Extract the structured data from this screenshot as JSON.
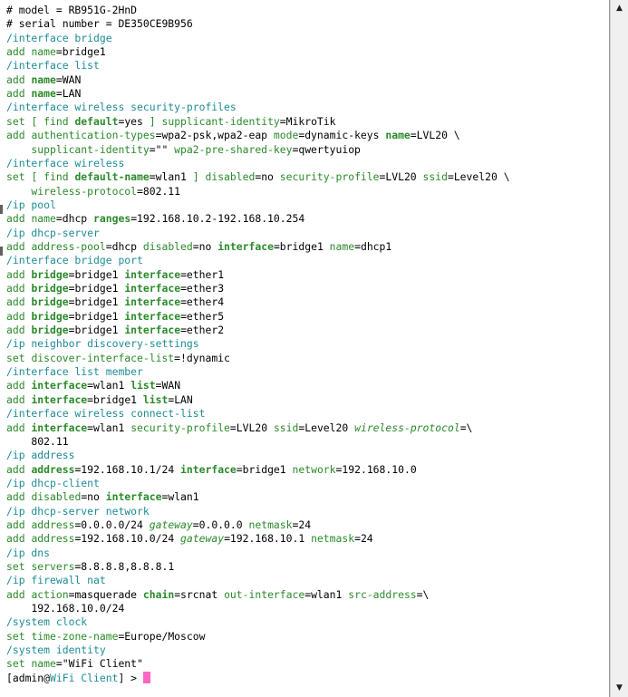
{
  "terminal": {
    "lines": [
      [
        {
          "t": "# model = RB951G-2HnD",
          "c": "c-val"
        }
      ],
      [
        {
          "t": "# serial number = DE350CE9B956",
          "c": "c-val"
        }
      ],
      [
        {
          "t": "/interface bridge",
          "c": "c-section"
        }
      ],
      [
        {
          "t": "add ",
          "c": "c-cmd"
        },
        {
          "t": "name",
          "c": "c-param"
        },
        {
          "t": "=bridge1",
          "c": "c-val"
        }
      ],
      [
        {
          "t": "/interface list",
          "c": "c-section"
        }
      ],
      [
        {
          "t": "add ",
          "c": "c-cmd"
        },
        {
          "t": "name",
          "c": "c-bparam"
        },
        {
          "t": "=WAN",
          "c": "c-val"
        }
      ],
      [
        {
          "t": "add ",
          "c": "c-cmd"
        },
        {
          "t": "name",
          "c": "c-bparam"
        },
        {
          "t": "=LAN",
          "c": "c-val"
        }
      ],
      [
        {
          "t": "/interface wireless security-profiles",
          "c": "c-section"
        }
      ],
      [
        {
          "t": "set ",
          "c": "c-cmd"
        },
        {
          "t": "[ find ",
          "c": "c-param"
        },
        {
          "t": "default",
          "c": "c-bparam"
        },
        {
          "t": "=yes ",
          "c": "c-val"
        },
        {
          "t": "] supplicant-identity",
          "c": "c-param"
        },
        {
          "t": "=MikroTik",
          "c": "c-val"
        }
      ],
      [
        {
          "t": "add ",
          "c": "c-cmd"
        },
        {
          "t": "authentication-types",
          "c": "c-param"
        },
        {
          "t": "=wpa2-psk,wpa2-eap ",
          "c": "c-val"
        },
        {
          "t": "mode",
          "c": "c-param"
        },
        {
          "t": "=dynamic-keys ",
          "c": "c-val"
        },
        {
          "t": "name",
          "c": "c-bparam"
        },
        {
          "t": "=LVL20 \\",
          "c": "c-val"
        }
      ],
      [
        {
          "t": "    supplicant-identity",
          "c": "c-param"
        },
        {
          "t": "=\"\" ",
          "c": "c-val"
        },
        {
          "t": "wpa2-pre-shared-key",
          "c": "c-param"
        },
        {
          "t": "=qwertyuiop",
          "c": "c-val"
        }
      ],
      [
        {
          "t": "/interface wireless",
          "c": "c-section"
        }
      ],
      [
        {
          "t": "set ",
          "c": "c-cmd"
        },
        {
          "t": "[ find ",
          "c": "c-param"
        },
        {
          "t": "default-name",
          "c": "c-bparam"
        },
        {
          "t": "=wlan1 ",
          "c": "c-val"
        },
        {
          "t": "] disabled",
          "c": "c-param"
        },
        {
          "t": "=no ",
          "c": "c-val"
        },
        {
          "t": "security-profile",
          "c": "c-param"
        },
        {
          "t": "=LVL20 ",
          "c": "c-val"
        },
        {
          "t": "ssid",
          "c": "c-param"
        },
        {
          "t": "=Level20 \\",
          "c": "c-val"
        }
      ],
      [
        {
          "t": "    wireless-protocol",
          "c": "c-param"
        },
        {
          "t": "=802.11",
          "c": "c-val"
        }
      ],
      [
        {
          "t": "/ip pool",
          "c": "c-section"
        }
      ],
      [
        {
          "t": "add ",
          "c": "c-cmd"
        },
        {
          "t": "name",
          "c": "c-param"
        },
        {
          "t": "=dhcp ",
          "c": "c-val"
        },
        {
          "t": "ranges",
          "c": "c-bparam"
        },
        {
          "t": "=192.168.10.2-192.168.10.254",
          "c": "c-val"
        }
      ],
      [
        {
          "t": "/ip dhcp-server",
          "c": "c-section"
        }
      ],
      [
        {
          "t": "add ",
          "c": "c-cmd"
        },
        {
          "t": "address-pool",
          "c": "c-param"
        },
        {
          "t": "=dhcp ",
          "c": "c-val"
        },
        {
          "t": "disabled",
          "c": "c-param"
        },
        {
          "t": "=no ",
          "c": "c-val"
        },
        {
          "t": "interface",
          "c": "c-bparam"
        },
        {
          "t": "=bridge1 ",
          "c": "c-val"
        },
        {
          "t": "name",
          "c": "c-param"
        },
        {
          "t": "=dhcp1",
          "c": "c-val"
        }
      ],
      [
        {
          "t": "/interface bridge port",
          "c": "c-section"
        }
      ],
      [
        {
          "t": "add ",
          "c": "c-cmd"
        },
        {
          "t": "bridge",
          "c": "c-bparam"
        },
        {
          "t": "=bridge1 ",
          "c": "c-val"
        },
        {
          "t": "interface",
          "c": "c-bparam"
        },
        {
          "t": "=ether1",
          "c": "c-val"
        }
      ],
      [
        {
          "t": "add ",
          "c": "c-cmd"
        },
        {
          "t": "bridge",
          "c": "c-bparam"
        },
        {
          "t": "=bridge1 ",
          "c": "c-val"
        },
        {
          "t": "interface",
          "c": "c-bparam"
        },
        {
          "t": "=ether3",
          "c": "c-val"
        }
      ],
      [
        {
          "t": "add ",
          "c": "c-cmd"
        },
        {
          "t": "bridge",
          "c": "c-bparam"
        },
        {
          "t": "=bridge1 ",
          "c": "c-val"
        },
        {
          "t": "interface",
          "c": "c-bparam"
        },
        {
          "t": "=ether4",
          "c": "c-val"
        }
      ],
      [
        {
          "t": "add ",
          "c": "c-cmd"
        },
        {
          "t": "bridge",
          "c": "c-bparam"
        },
        {
          "t": "=bridge1 ",
          "c": "c-val"
        },
        {
          "t": "interface",
          "c": "c-bparam"
        },
        {
          "t": "=ether5",
          "c": "c-val"
        }
      ],
      [
        {
          "t": "add ",
          "c": "c-cmd"
        },
        {
          "t": "bridge",
          "c": "c-bparam"
        },
        {
          "t": "=bridge1 ",
          "c": "c-val"
        },
        {
          "t": "interface",
          "c": "c-bparam"
        },
        {
          "t": "=ether2",
          "c": "c-val"
        }
      ],
      [
        {
          "t": "/ip neighbor discovery-settings",
          "c": "c-section"
        }
      ],
      [
        {
          "t": "set ",
          "c": "c-cmd"
        },
        {
          "t": "discover-interface-list",
          "c": "c-param"
        },
        {
          "t": "=!dynamic",
          "c": "c-val"
        }
      ],
      [
        {
          "t": "/interface list member",
          "c": "c-section"
        }
      ],
      [
        {
          "t": "add ",
          "c": "c-cmd"
        },
        {
          "t": "interface",
          "c": "c-bparam"
        },
        {
          "t": "=wlan1 ",
          "c": "c-val"
        },
        {
          "t": "list",
          "c": "c-bparam"
        },
        {
          "t": "=WAN",
          "c": "c-val"
        }
      ],
      [
        {
          "t": "add ",
          "c": "c-cmd"
        },
        {
          "t": "interface",
          "c": "c-bparam"
        },
        {
          "t": "=bridge1 ",
          "c": "c-val"
        },
        {
          "t": "list",
          "c": "c-bparam"
        },
        {
          "t": "=LAN",
          "c": "c-val"
        }
      ],
      [
        {
          "t": "/interface wireless connect-list",
          "c": "c-section"
        }
      ],
      [
        {
          "t": "add ",
          "c": "c-cmd"
        },
        {
          "t": "interface",
          "c": "c-bparam"
        },
        {
          "t": "=wlan1 ",
          "c": "c-val"
        },
        {
          "t": "security-profile",
          "c": "c-param"
        },
        {
          "t": "=LVL20 ",
          "c": "c-val"
        },
        {
          "t": "ssid",
          "c": "c-param"
        },
        {
          "t": "=Level20 ",
          "c": "c-val"
        },
        {
          "t": "wireless-protocol",
          "c": "c-ital"
        },
        {
          "t": "=\\",
          "c": "c-val"
        }
      ],
      [
        {
          "t": "    802.11",
          "c": "c-val"
        }
      ],
      [
        {
          "t": "/ip address",
          "c": "c-section"
        }
      ],
      [
        {
          "t": "add ",
          "c": "c-cmd"
        },
        {
          "t": "address",
          "c": "c-bparam"
        },
        {
          "t": "=192.168.10.1/24 ",
          "c": "c-val"
        },
        {
          "t": "interface",
          "c": "c-bparam"
        },
        {
          "t": "=bridge1 ",
          "c": "c-val"
        },
        {
          "t": "network",
          "c": "c-param"
        },
        {
          "t": "=192.168.10.0",
          "c": "c-val"
        }
      ],
      [
        {
          "t": "/ip dhcp-client",
          "c": "c-section"
        }
      ],
      [
        {
          "t": "add ",
          "c": "c-cmd"
        },
        {
          "t": "disabled",
          "c": "c-param"
        },
        {
          "t": "=no ",
          "c": "c-val"
        },
        {
          "t": "interface",
          "c": "c-bparam"
        },
        {
          "t": "=wlan1",
          "c": "c-val"
        }
      ],
      [
        {
          "t": "/ip dhcp-server network",
          "c": "c-section"
        }
      ],
      [
        {
          "t": "add ",
          "c": "c-cmd"
        },
        {
          "t": "address",
          "c": "c-param"
        },
        {
          "t": "=0.0.0.0/24 ",
          "c": "c-val"
        },
        {
          "t": "gateway",
          "c": "c-ital"
        },
        {
          "t": "=0.0.0.0 ",
          "c": "c-val"
        },
        {
          "t": "netmask",
          "c": "c-param"
        },
        {
          "t": "=24",
          "c": "c-val"
        }
      ],
      [
        {
          "t": "add ",
          "c": "c-cmd"
        },
        {
          "t": "address",
          "c": "c-param"
        },
        {
          "t": "=192.168.10.0/24 ",
          "c": "c-val"
        },
        {
          "t": "gateway",
          "c": "c-ital"
        },
        {
          "t": "=192.168.10.1 ",
          "c": "c-val"
        },
        {
          "t": "netmask",
          "c": "c-param"
        },
        {
          "t": "=24",
          "c": "c-val"
        }
      ],
      [
        {
          "t": "/ip dns",
          "c": "c-section"
        }
      ],
      [
        {
          "t": "set ",
          "c": "c-cmd"
        },
        {
          "t": "servers",
          "c": "c-param"
        },
        {
          "t": "=8.8.8.8,8.8.8.1",
          "c": "c-val"
        }
      ],
      [
        {
          "t": "/ip firewall nat",
          "c": "c-section"
        }
      ],
      [
        {
          "t": "add ",
          "c": "c-cmd"
        },
        {
          "t": "action",
          "c": "c-param"
        },
        {
          "t": "=masquerade ",
          "c": "c-val"
        },
        {
          "t": "chain",
          "c": "c-bparam"
        },
        {
          "t": "=srcnat ",
          "c": "c-val"
        },
        {
          "t": "out-interface",
          "c": "c-param"
        },
        {
          "t": "=wlan1 ",
          "c": "c-val"
        },
        {
          "t": "src-address",
          "c": "c-param"
        },
        {
          "t": "=\\",
          "c": "c-val"
        }
      ],
      [
        {
          "t": "    192.168.10.0/24",
          "c": "c-val"
        }
      ],
      [
        {
          "t": "/system clock",
          "c": "c-section"
        }
      ],
      [
        {
          "t": "set ",
          "c": "c-cmd"
        },
        {
          "t": "time-zone-name",
          "c": "c-param"
        },
        {
          "t": "=Europe/Moscow",
          "c": "c-val"
        }
      ],
      [
        {
          "t": "/system identity",
          "c": "c-section"
        }
      ],
      [
        {
          "t": "set ",
          "c": "c-cmd"
        },
        {
          "t": "name",
          "c": "c-param"
        },
        {
          "t": "=\"WiFi Client\"",
          "c": "c-val"
        }
      ]
    ],
    "prompt": {
      "open": "[",
      "user": "admin",
      "at": "@",
      "host": "WiFi Client",
      "close": "] > "
    },
    "colors": {
      "section": "#1e8c96",
      "command": "#2a8a2a",
      "value": "#000000",
      "cursor": "#ff66c4"
    }
  },
  "scrollbar": {
    "up_icon": "▲",
    "down_icon": "▼"
  }
}
